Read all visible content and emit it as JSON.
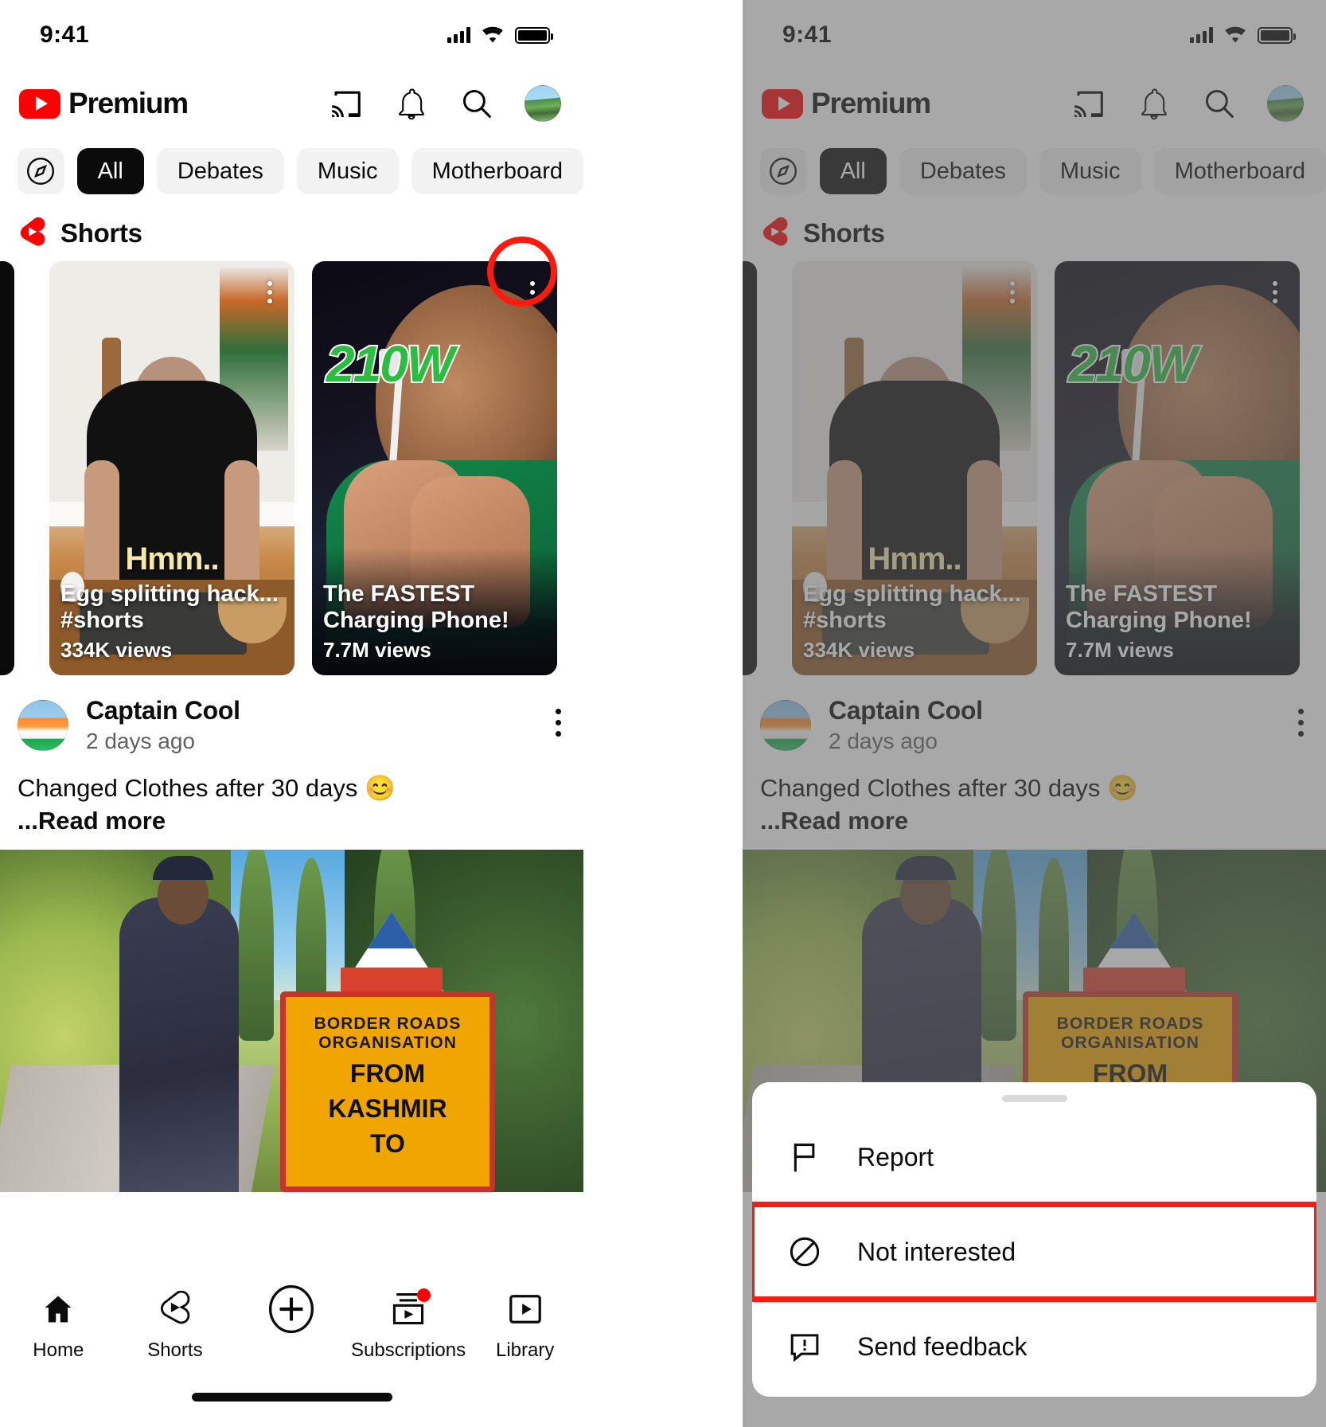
{
  "status_bar": {
    "time": "9:41",
    "icons": [
      "cellular-signal-icon",
      "wifi-icon",
      "battery-icon"
    ]
  },
  "app_bar": {
    "brand": "Premium",
    "logo_name": "youtube-logo",
    "actions": [
      {
        "name": "cast-icon",
        "label": "Cast"
      },
      {
        "name": "notifications-bell-icon",
        "label": "Notifications"
      },
      {
        "name": "search-icon",
        "label": "Search"
      },
      {
        "name": "account-avatar",
        "label": "Account"
      }
    ]
  },
  "chips": [
    {
      "label": "",
      "name": "explore-compass-chip",
      "active": false,
      "icon": "compass-icon"
    },
    {
      "label": "All",
      "name": "chip-all",
      "active": true
    },
    {
      "label": "Debates",
      "name": "chip-debates",
      "active": false
    },
    {
      "label": "Music",
      "name": "chip-music",
      "active": false
    },
    {
      "label": "Motherboard",
      "name": "chip-motherboard",
      "active": false
    }
  ],
  "shorts_section": {
    "title": "Shorts",
    "logo_name": "shorts-logo-icon",
    "cards": [
      {
        "caption_overlay": "Hmm..",
        "title": "Egg splitting hack...",
        "subtitle": "#shorts",
        "views": "334K views",
        "menu_name": "shorts-card-menu-icon"
      },
      {
        "caption_overlay": "210W",
        "title_line1": "The FASTEST",
        "title_line2": "Charging Phone!",
        "views": "7.7M views",
        "menu_name": "shorts-card-menu-icon"
      }
    ]
  },
  "post": {
    "author": "Captain Cool",
    "timestamp": "2 days ago",
    "text": "Changed Clothes after 30 days 😊",
    "read_more": "...Read more",
    "menu_name": "post-overflow-menu-icon",
    "photo": {
      "sign_line1": "BORDER ROADS ORGANISATION",
      "sign_line2": "FROM",
      "sign_line3": "KASHMIR",
      "sign_line4": "TO"
    }
  },
  "tab_bar": [
    {
      "label": "Home",
      "name": "tab-home",
      "icon": "home-icon",
      "badge": false
    },
    {
      "label": "Shorts",
      "name": "tab-shorts",
      "icon": "shorts-icon",
      "badge": false
    },
    {
      "label": "",
      "name": "tab-create",
      "icon": "plus-circle-icon",
      "badge": false
    },
    {
      "label": "Subscriptions",
      "name": "tab-subscriptions",
      "icon": "subscriptions-icon",
      "badge": true
    },
    {
      "label": "Library",
      "name": "tab-library",
      "icon": "library-icon",
      "badge": false
    }
  ],
  "bottom_sheet": {
    "items": [
      {
        "label": "Report",
        "name": "sheet-item-report",
        "icon": "flag-icon",
        "highlighted": false
      },
      {
        "label": "Not interested",
        "name": "sheet-item-not-interested",
        "icon": "not-interested-icon",
        "highlighted": true
      },
      {
        "label": "Send feedback",
        "name": "sheet-item-send-feedback",
        "icon": "feedback-icon",
        "highlighted": false
      }
    ]
  },
  "annotations": {
    "highlight_color": "#FF1A0F",
    "circle_target": "shorts-card-menu-icon",
    "box_target": "sheet-item-not-interested"
  }
}
